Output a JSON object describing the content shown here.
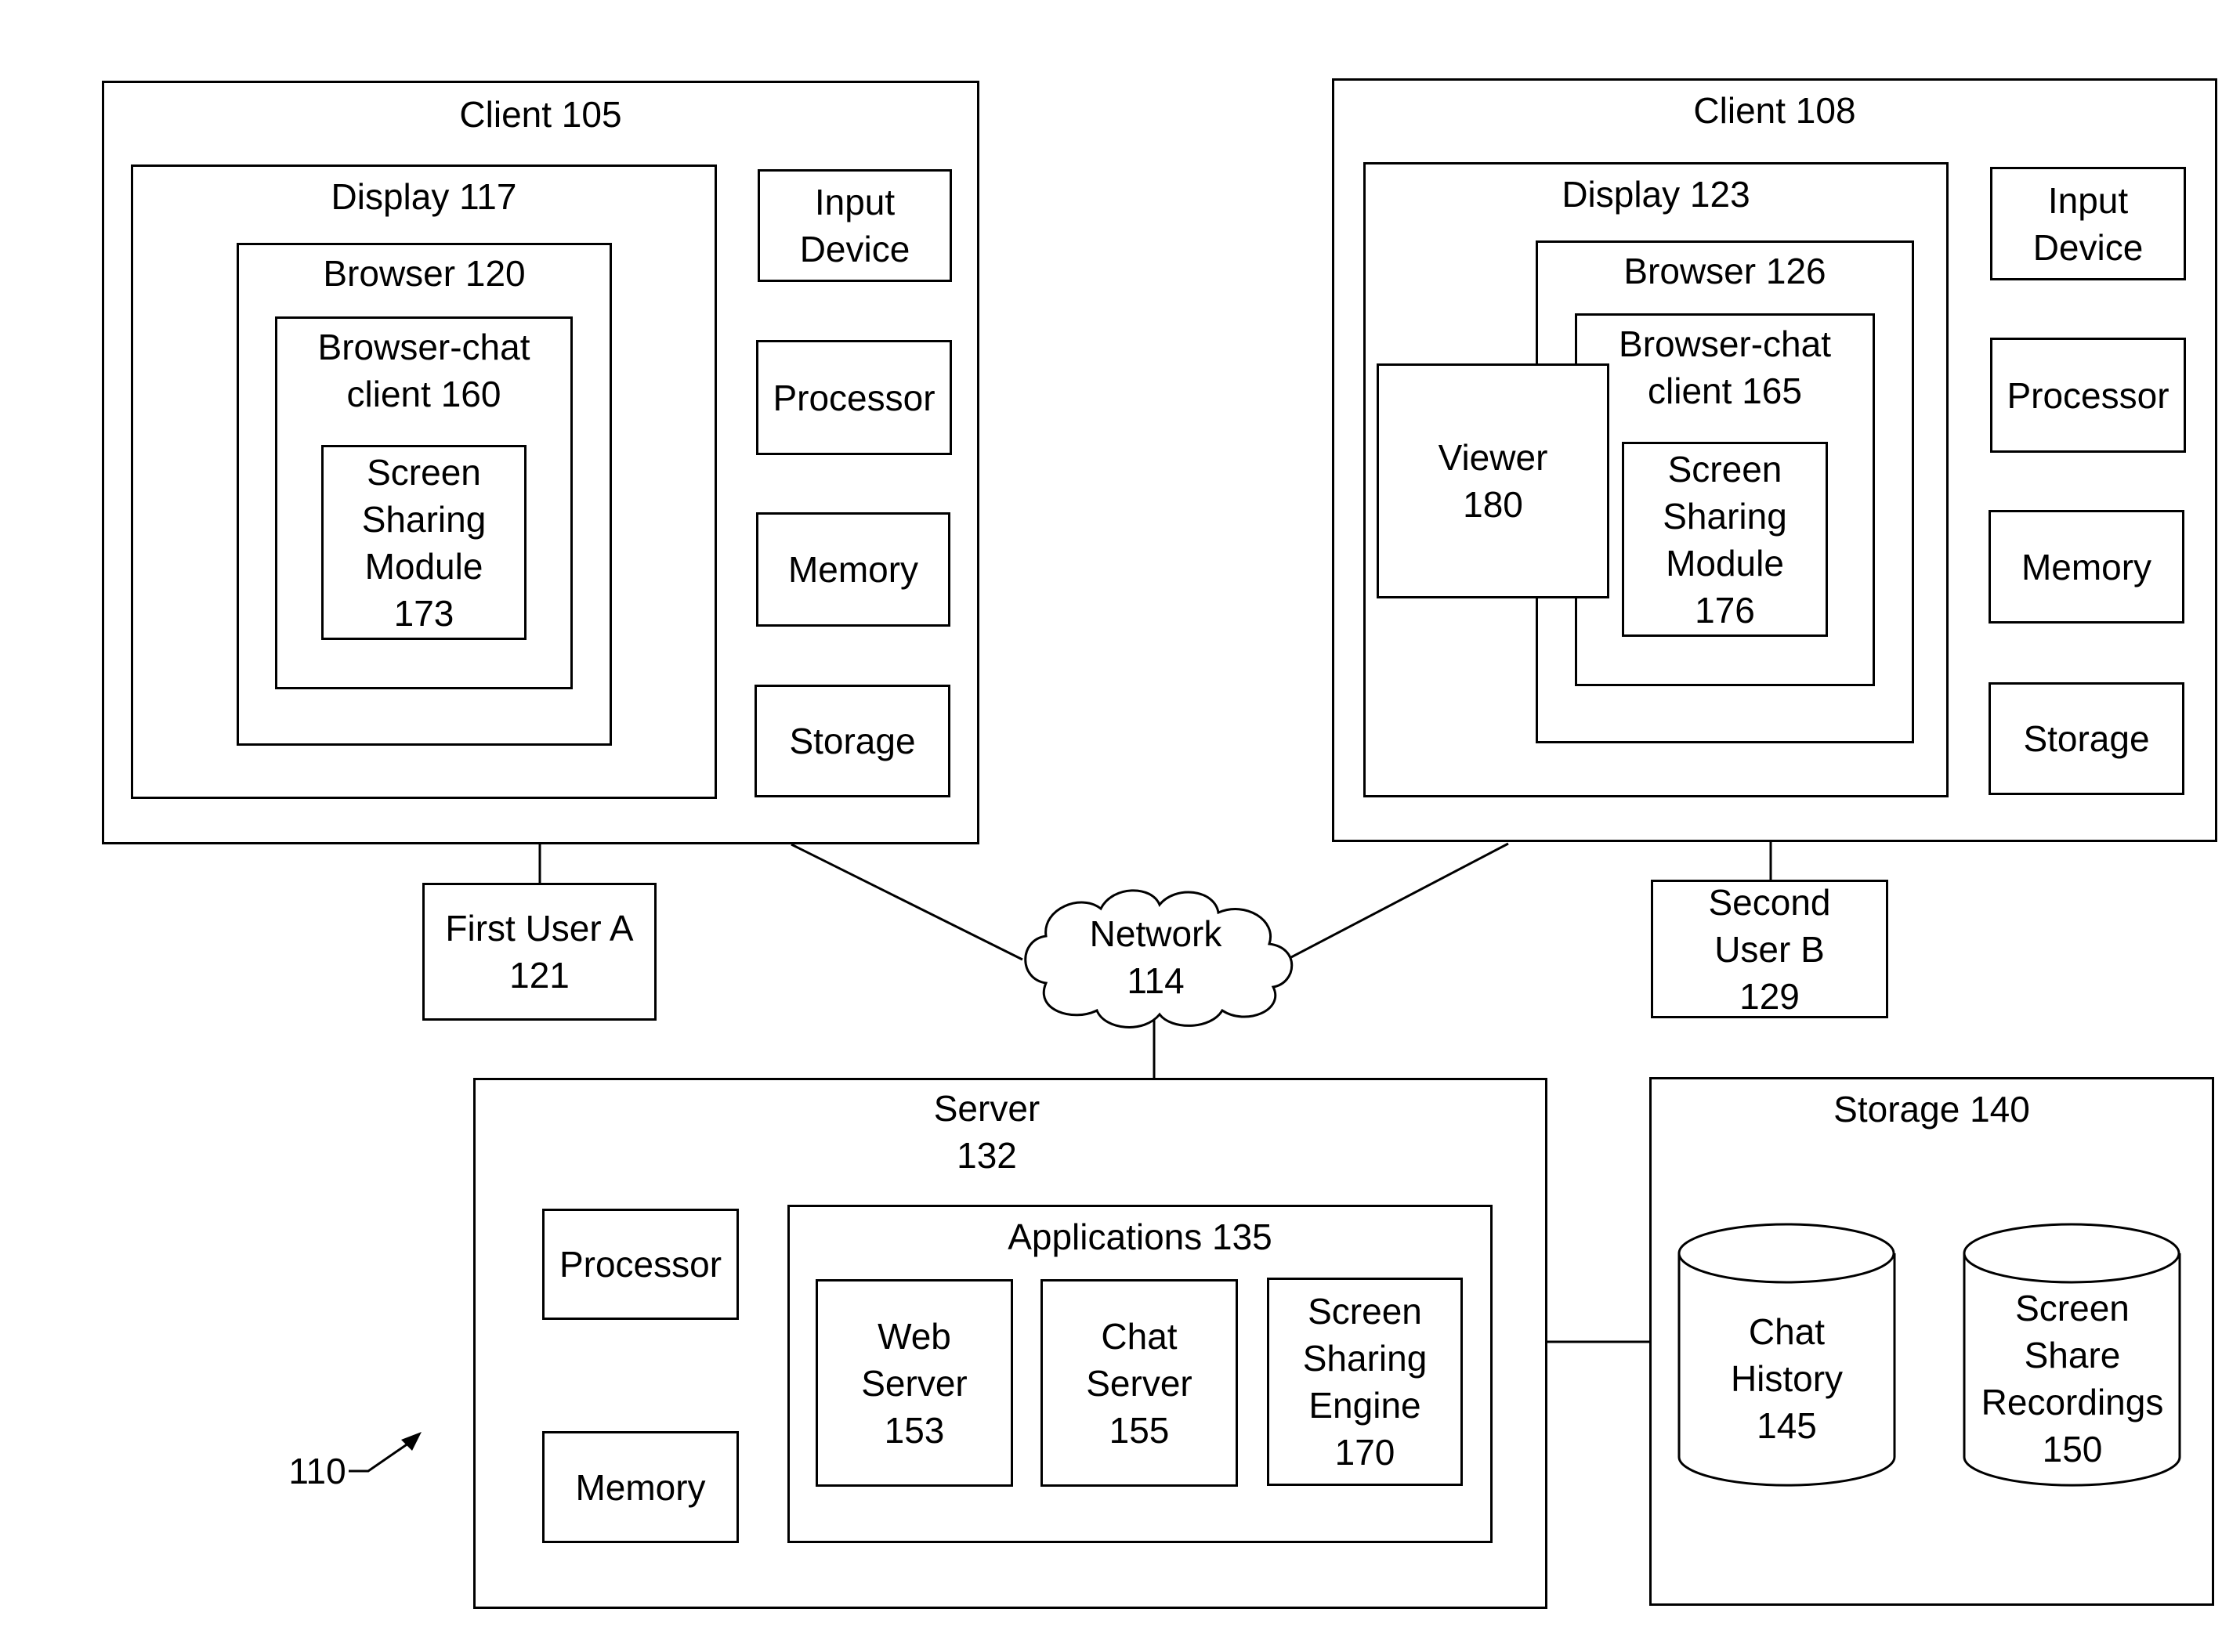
{
  "figure_ref": "110",
  "client_a": {
    "title": "Client 105",
    "display": "Display 117",
    "browser": "Browser 120",
    "chat_client": "Browser-chat\nclient 160",
    "screen_module": "Screen\nSharing\nModule\n173",
    "input_device": "Input\nDevice",
    "processor": "Processor",
    "memory": "Memory",
    "storage": "Storage"
  },
  "client_b": {
    "title": "Client 108",
    "display": "Display 123",
    "browser": "Browser 126",
    "chat_client": "Browser-chat\nclient 165",
    "viewer": "Viewer\n180",
    "screen_module": "Screen\nSharing\nModule\n176",
    "input_device": "Input\nDevice",
    "processor": "Processor",
    "memory": "Memory",
    "storage": "Storage"
  },
  "user_a": "First User A\n121",
  "user_b": "Second\nUser B\n129",
  "network": "Network\n114",
  "server": {
    "title": "Server\n132",
    "processor": "Processor",
    "memory": "Memory",
    "applications": "Applications 135",
    "web_server": "Web\nServer\n153",
    "chat_server": "Chat\nServer\n155",
    "sharing_engine": "Screen\nSharing\nEngine\n170"
  },
  "storage": {
    "title": "Storage 140",
    "chat_history": "Chat\nHistory\n145",
    "recordings": "Screen\nShare\nRecordings\n150"
  }
}
